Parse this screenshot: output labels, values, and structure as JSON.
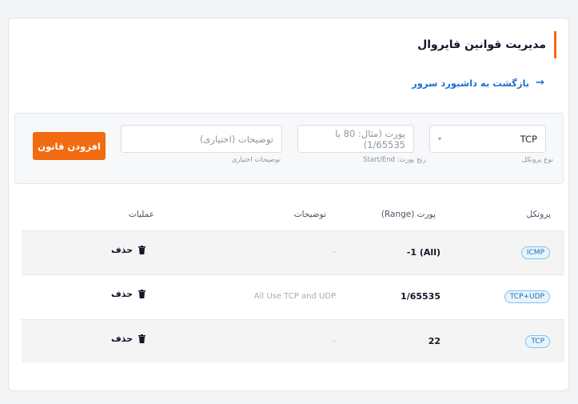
{
  "header": {
    "title": "مدیریت قوانین فایروال"
  },
  "back_link": {
    "label": "بازگشت به داشبورد سرور"
  },
  "form": {
    "protocol": {
      "value": "TCP",
      "label": "نوع پروتکل"
    },
    "port": {
      "placeholder": "پورت (مثال: 80 یا 1/65535)",
      "label": "رنج پورت: Start/End"
    },
    "description": {
      "placeholder": "توضیحات (اختیاری)",
      "label": "توضیحات اختیاری"
    },
    "add_button": "افزودن قانون"
  },
  "table": {
    "headers": {
      "protocol": "پروتکل",
      "port": "پورت (Range)",
      "description": "توضیحات",
      "operations": "عملیات"
    },
    "rows": [
      {
        "protocol": "ICMP",
        "port": "-1 (All)",
        "description": "-",
        "action": "حذف"
      },
      {
        "protocol": "TCP+UDP",
        "port": "1/65535",
        "description": "All Use TCP and UDP",
        "action": "حذف"
      },
      {
        "protocol": "TCP",
        "port": "22",
        "description": "-",
        "action": "حذف"
      }
    ]
  },
  "colors": {
    "accent": "#f26b10",
    "link": "#1f6fd1",
    "badge_border": "#7cc3ee"
  }
}
